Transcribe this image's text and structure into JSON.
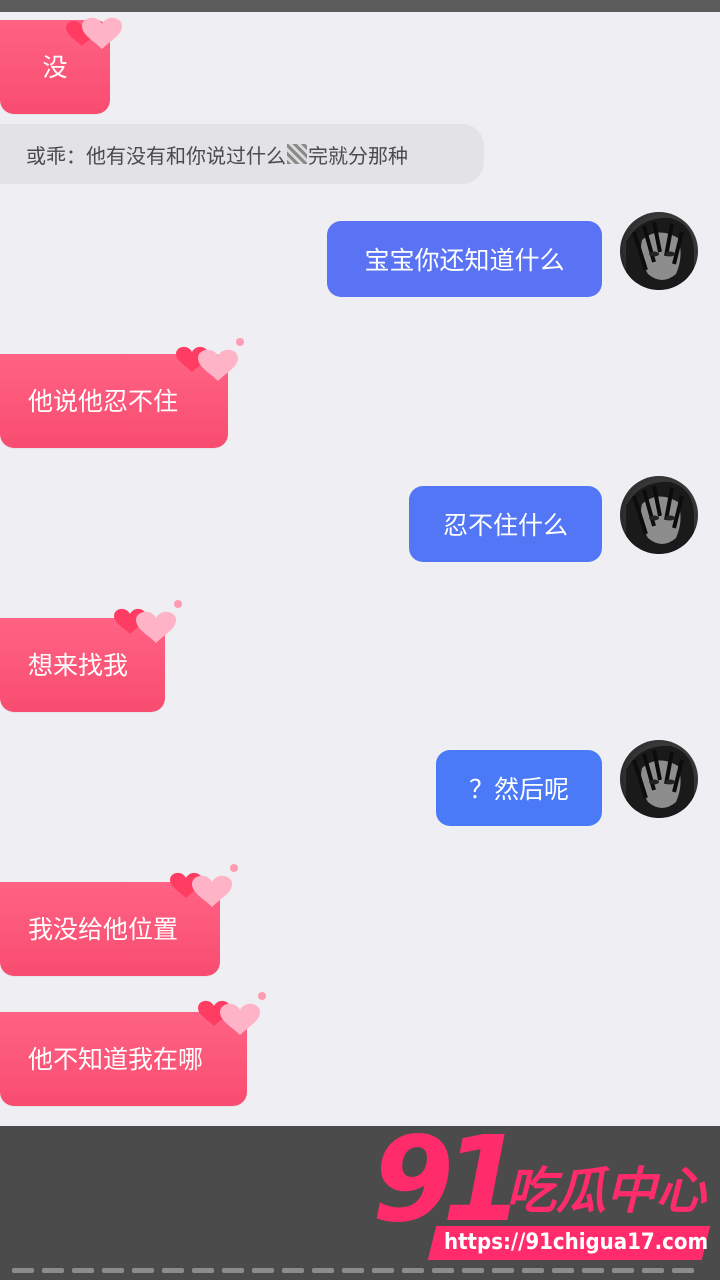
{
  "messages": [
    {
      "side": "left",
      "text": "没"
    },
    {
      "side": "system",
      "prefix": "或乖：他有没有和你说过什么",
      "suffix": "完就分那种"
    },
    {
      "side": "right",
      "text": "宝宝你还知道什么"
    },
    {
      "side": "left",
      "text": "他说他忍不住"
    },
    {
      "side": "right",
      "text": "忍不住什么"
    },
    {
      "side": "left",
      "text": "想来找我"
    },
    {
      "side": "right",
      "text": "？然后呢"
    },
    {
      "side": "left",
      "text": "我没给他位置"
    },
    {
      "side": "left",
      "text": "他不知道我在哪"
    }
  ],
  "watermark": {
    "logo": "91",
    "name": "吃瓜中心",
    "url": "https://91chigua17.com"
  },
  "colors": {
    "left_bubble": "#f84c70",
    "right_bubble_a": "#5a73f5",
    "right_bubble_b": "#4a7af7",
    "system_bg": "#e3e2e7",
    "background": "#efeef2",
    "brand": "#ff2b6a"
  }
}
